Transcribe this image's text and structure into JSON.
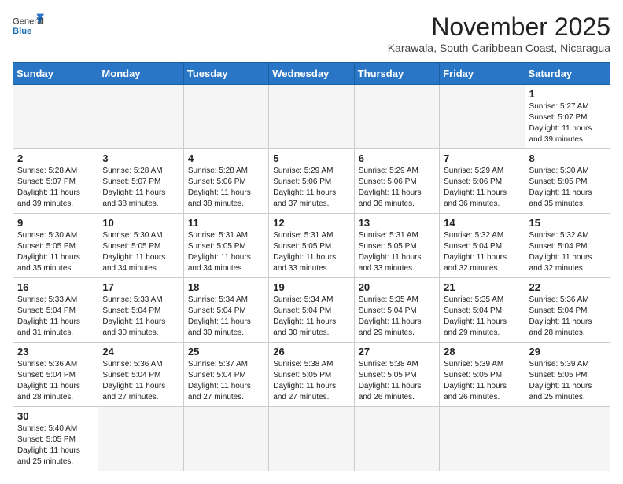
{
  "header": {
    "logo_line1": "General",
    "logo_line2": "Blue",
    "month_title": "November 2025",
    "location": "Karawala, South Caribbean Coast, Nicaragua"
  },
  "days_of_week": [
    "Sunday",
    "Monday",
    "Tuesday",
    "Wednesday",
    "Thursday",
    "Friday",
    "Saturday"
  ],
  "weeks": [
    [
      {
        "day": "",
        "info": ""
      },
      {
        "day": "",
        "info": ""
      },
      {
        "day": "",
        "info": ""
      },
      {
        "day": "",
        "info": ""
      },
      {
        "day": "",
        "info": ""
      },
      {
        "day": "",
        "info": ""
      },
      {
        "day": "1",
        "info": "Sunrise: 5:27 AM\nSunset: 5:07 PM\nDaylight: 11 hours\nand 39 minutes."
      }
    ],
    [
      {
        "day": "2",
        "info": "Sunrise: 5:28 AM\nSunset: 5:07 PM\nDaylight: 11 hours\nand 39 minutes."
      },
      {
        "day": "3",
        "info": "Sunrise: 5:28 AM\nSunset: 5:07 PM\nDaylight: 11 hours\nand 38 minutes."
      },
      {
        "day": "4",
        "info": "Sunrise: 5:28 AM\nSunset: 5:06 PM\nDaylight: 11 hours\nand 38 minutes."
      },
      {
        "day": "5",
        "info": "Sunrise: 5:29 AM\nSunset: 5:06 PM\nDaylight: 11 hours\nand 37 minutes."
      },
      {
        "day": "6",
        "info": "Sunrise: 5:29 AM\nSunset: 5:06 PM\nDaylight: 11 hours\nand 36 minutes."
      },
      {
        "day": "7",
        "info": "Sunrise: 5:29 AM\nSunset: 5:06 PM\nDaylight: 11 hours\nand 36 minutes."
      },
      {
        "day": "8",
        "info": "Sunrise: 5:30 AM\nSunset: 5:05 PM\nDaylight: 11 hours\nand 35 minutes."
      }
    ],
    [
      {
        "day": "9",
        "info": "Sunrise: 5:30 AM\nSunset: 5:05 PM\nDaylight: 11 hours\nand 35 minutes."
      },
      {
        "day": "10",
        "info": "Sunrise: 5:30 AM\nSunset: 5:05 PM\nDaylight: 11 hours\nand 34 minutes."
      },
      {
        "day": "11",
        "info": "Sunrise: 5:31 AM\nSunset: 5:05 PM\nDaylight: 11 hours\nand 34 minutes."
      },
      {
        "day": "12",
        "info": "Sunrise: 5:31 AM\nSunset: 5:05 PM\nDaylight: 11 hours\nand 33 minutes."
      },
      {
        "day": "13",
        "info": "Sunrise: 5:31 AM\nSunset: 5:05 PM\nDaylight: 11 hours\nand 33 minutes."
      },
      {
        "day": "14",
        "info": "Sunrise: 5:32 AM\nSunset: 5:04 PM\nDaylight: 11 hours\nand 32 minutes."
      },
      {
        "day": "15",
        "info": "Sunrise: 5:32 AM\nSunset: 5:04 PM\nDaylight: 11 hours\nand 32 minutes."
      }
    ],
    [
      {
        "day": "16",
        "info": "Sunrise: 5:33 AM\nSunset: 5:04 PM\nDaylight: 11 hours\nand 31 minutes."
      },
      {
        "day": "17",
        "info": "Sunrise: 5:33 AM\nSunset: 5:04 PM\nDaylight: 11 hours\nand 30 minutes."
      },
      {
        "day": "18",
        "info": "Sunrise: 5:34 AM\nSunset: 5:04 PM\nDaylight: 11 hours\nand 30 minutes."
      },
      {
        "day": "19",
        "info": "Sunrise: 5:34 AM\nSunset: 5:04 PM\nDaylight: 11 hours\nand 30 minutes."
      },
      {
        "day": "20",
        "info": "Sunrise: 5:35 AM\nSunset: 5:04 PM\nDaylight: 11 hours\nand 29 minutes."
      },
      {
        "day": "21",
        "info": "Sunrise: 5:35 AM\nSunset: 5:04 PM\nDaylight: 11 hours\nand 29 minutes."
      },
      {
        "day": "22",
        "info": "Sunrise: 5:36 AM\nSunset: 5:04 PM\nDaylight: 11 hours\nand 28 minutes."
      }
    ],
    [
      {
        "day": "23",
        "info": "Sunrise: 5:36 AM\nSunset: 5:04 PM\nDaylight: 11 hours\nand 28 minutes."
      },
      {
        "day": "24",
        "info": "Sunrise: 5:36 AM\nSunset: 5:04 PM\nDaylight: 11 hours\nand 27 minutes."
      },
      {
        "day": "25",
        "info": "Sunrise: 5:37 AM\nSunset: 5:04 PM\nDaylight: 11 hours\nand 27 minutes."
      },
      {
        "day": "26",
        "info": "Sunrise: 5:38 AM\nSunset: 5:05 PM\nDaylight: 11 hours\nand 27 minutes."
      },
      {
        "day": "27",
        "info": "Sunrise: 5:38 AM\nSunset: 5:05 PM\nDaylight: 11 hours\nand 26 minutes."
      },
      {
        "day": "28",
        "info": "Sunrise: 5:39 AM\nSunset: 5:05 PM\nDaylight: 11 hours\nand 26 minutes."
      },
      {
        "day": "29",
        "info": "Sunrise: 5:39 AM\nSunset: 5:05 PM\nDaylight: 11 hours\nand 25 minutes."
      }
    ],
    [
      {
        "day": "30",
        "info": "Sunrise: 5:40 AM\nSunset: 5:05 PM\nDaylight: 11 hours\nand 25 minutes."
      },
      {
        "day": "",
        "info": ""
      },
      {
        "day": "",
        "info": ""
      },
      {
        "day": "",
        "info": ""
      },
      {
        "day": "",
        "info": ""
      },
      {
        "day": "",
        "info": ""
      },
      {
        "day": "",
        "info": ""
      }
    ]
  ]
}
